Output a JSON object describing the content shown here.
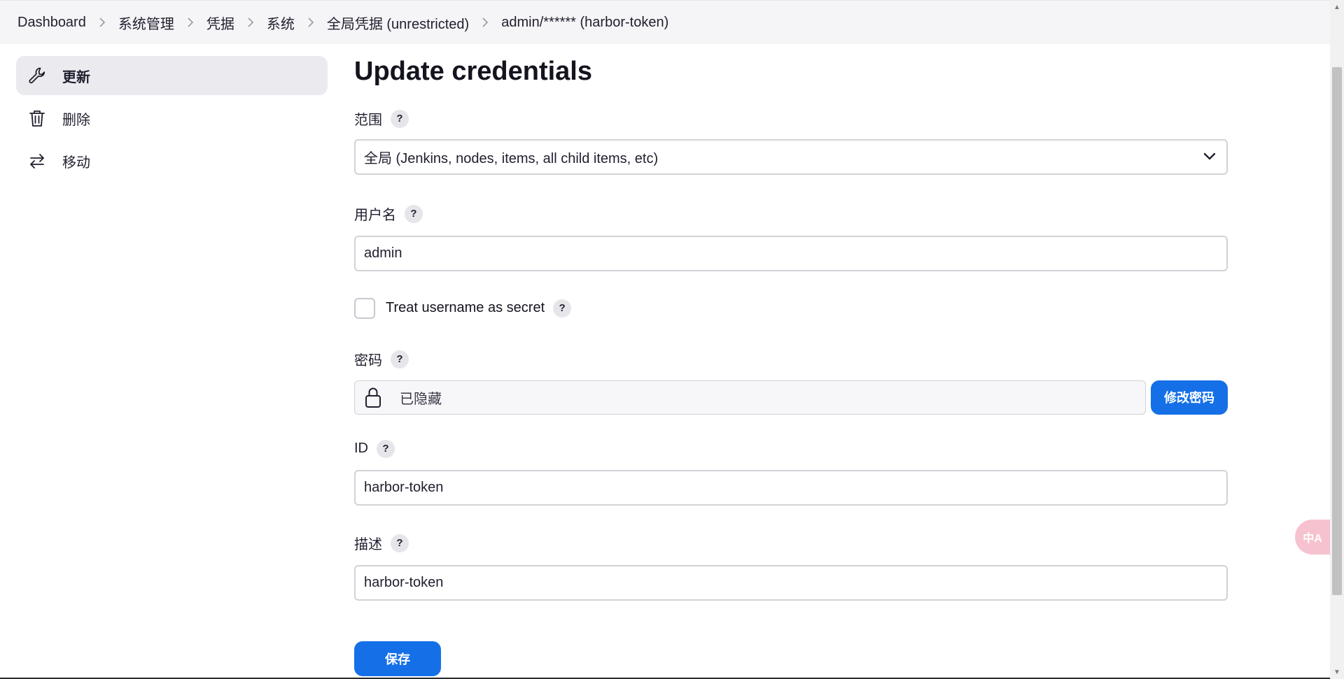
{
  "breadcrumb": [
    {
      "label": "Dashboard"
    },
    {
      "label": "系统管理"
    },
    {
      "label": "凭据"
    },
    {
      "label": "系统"
    },
    {
      "label": "全局凭据 (unrestricted)"
    },
    {
      "label": "admin/****** (harbor-token)"
    }
  ],
  "sidebar": {
    "items": [
      {
        "label": "更新",
        "icon": "wrench-icon",
        "active": true
      },
      {
        "label": "删除",
        "icon": "trash-icon",
        "active": false
      },
      {
        "label": "移动",
        "icon": "swap-arrows-icon",
        "active": false
      }
    ]
  },
  "main": {
    "title": "Update credentials",
    "scope": {
      "label": "范围",
      "value": "全局 (Jenkins, nodes, items, all child items, etc)"
    },
    "username": {
      "label": "用户名",
      "value": "admin"
    },
    "treat_secret": {
      "label": "Treat username as secret",
      "checked": false
    },
    "password": {
      "label": "密码",
      "value": "已隐藏",
      "change_button": "修改密码"
    },
    "id": {
      "label": "ID",
      "value": "harbor-token"
    },
    "description": {
      "label": "描述",
      "value": "harbor-token"
    },
    "save_button": "保存"
  },
  "help_glyph": "?",
  "translate_widget": {
    "label": "中A"
  },
  "colors": {
    "accent": "#1570e8",
    "topbar_bg": "#f5f5f7",
    "active_sidebar_bg": "#ebebef",
    "translate_widget_bg": "#f6c2cf"
  }
}
